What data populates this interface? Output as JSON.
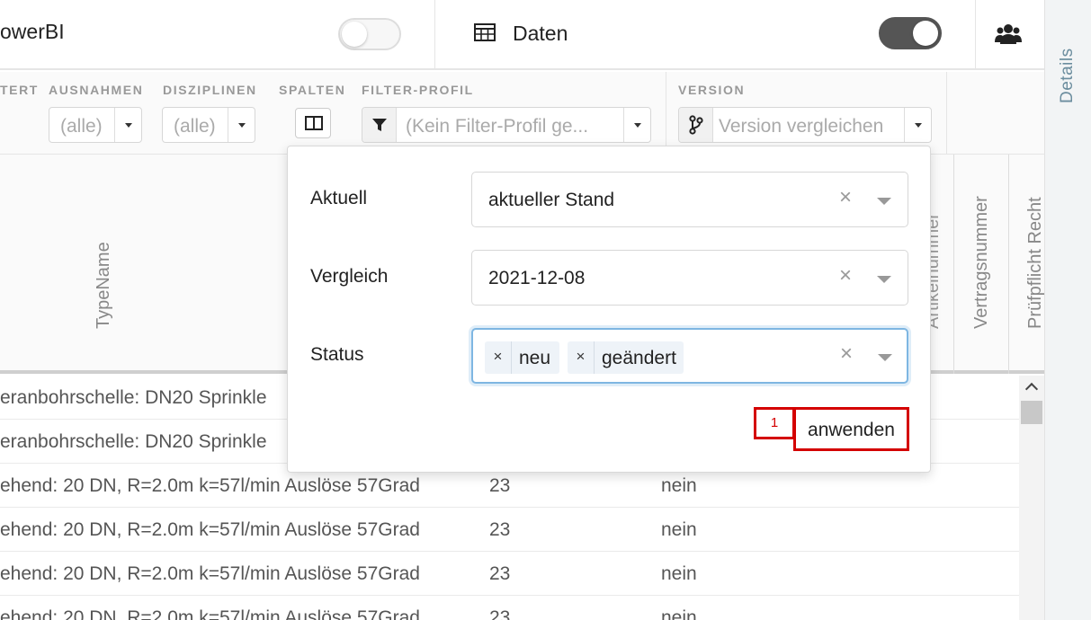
{
  "topbar": {
    "app_title": "owerBI",
    "daten_label": "Daten"
  },
  "sidebar": {
    "details_label": "Details"
  },
  "filters": {
    "labels": [
      "TERT",
      "AUSNAHMEN",
      "DISZIPLINEN",
      "SPALTEN",
      "FILTER-PROFIL",
      "VERSION"
    ],
    "ausnahmen_value": "(alle)",
    "disziplinen_value": "(alle)",
    "filter_profil_placeholder": "(Kein Filter-Profil ge...",
    "version_placeholder": "Version vergleichen"
  },
  "table": {
    "headers": [
      "TypeName",
      "Artikelnummer",
      "Vertragsnummer",
      "Prüfpflicht Recht"
    ],
    "rows": [
      [
        "eranbohrschelle: DN20 Sprinkle",
        "",
        ""
      ],
      [
        "eranbohrschelle: DN20 Sprinkle",
        "",
        ""
      ],
      [
        "ehend: 20 DN, R=2.0m k=57l/min Auslöse 57Grad",
        "23",
        "nein"
      ],
      [
        "ehend: 20 DN, R=2.0m k=57l/min Auslöse 57Grad",
        "23",
        "nein"
      ],
      [
        "ehend: 20 DN, R=2.0m k=57l/min Auslöse 57Grad",
        "23",
        "nein"
      ],
      [
        "ehend: 20 DN, R=2.0m k=57l/min Auslöse 57Grad",
        "23",
        "nein"
      ]
    ]
  },
  "popup": {
    "aktuell_label": "Aktuell",
    "aktuell_value": "aktueller Stand",
    "vergleich_label": "Vergleich",
    "vergleich_value": "2021-12-08",
    "status_label": "Status",
    "status_tags": [
      "neu",
      "geändert"
    ],
    "clear_symbol": "×",
    "apply_label": "anwenden"
  },
  "annotation": {
    "marker_number": "1",
    "color": "#d40000"
  }
}
